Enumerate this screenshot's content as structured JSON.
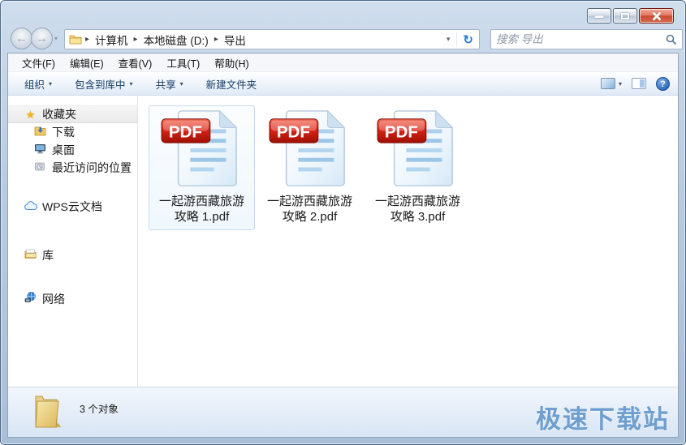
{
  "window": {
    "title": ""
  },
  "icons": {
    "back": "←",
    "forward": "→",
    "dropdown": "▾",
    "separator": "▸",
    "refresh": "↻"
  },
  "navigation": {
    "breadcrumb": [
      "计算机",
      "本地磁盘 (D:)",
      "导出"
    ],
    "search_placeholder": "搜索 导出"
  },
  "menu": {
    "items": [
      "文件(F)",
      "编辑(E)",
      "查看(V)",
      "工具(T)",
      "帮助(H)"
    ]
  },
  "toolbar": {
    "organize": "组织",
    "include_in_library": "包含到库中",
    "share": "共享",
    "new_folder": "新建文件夹",
    "help_glyph": "?"
  },
  "sidebar": {
    "favorites": "收藏夹",
    "downloads": "下载",
    "desktop": "桌面",
    "recent_places": "最近访问的位置",
    "wps_cloud": "WPS云文档",
    "libraries": "库",
    "network": "网络"
  },
  "files": {
    "badge": "PDF",
    "items": [
      {
        "name": "一起游西藏旅游攻略 1.pdf",
        "selected": true
      },
      {
        "name": "一起游西藏旅游攻略 2.pdf",
        "selected": false
      },
      {
        "name": "一起游西藏旅游攻略 3.pdf",
        "selected": false
      }
    ]
  },
  "status": {
    "count": "3 个对象"
  },
  "watermark": "极速下载站"
}
